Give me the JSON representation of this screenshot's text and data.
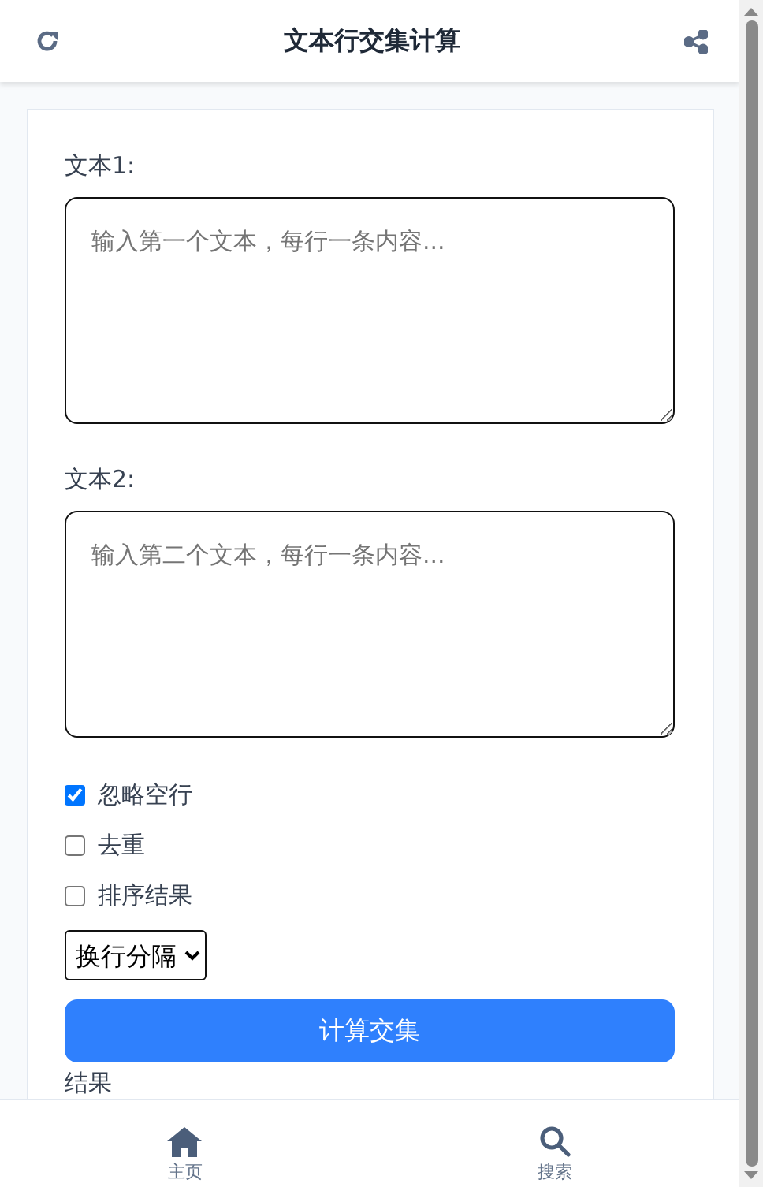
{
  "header": {
    "title": "文本行交集计算"
  },
  "form": {
    "text1": {
      "label": "文本1:",
      "placeholder": "输入第一个文本，每行一条内容..."
    },
    "text2": {
      "label": "文本2:",
      "placeholder": "输入第二个文本，每行一条内容..."
    },
    "options": [
      {
        "label": "忽略空行",
        "checked": true
      },
      {
        "label": "去重",
        "checked": false
      },
      {
        "label": "排序结果",
        "checked": false
      }
    ],
    "separator": {
      "value": "换行分隔"
    },
    "submit": {
      "label": "计算交集"
    },
    "result": {
      "label": "结果"
    }
  },
  "bottom_nav": [
    {
      "kind": "home",
      "label": "主页"
    },
    {
      "kind": "search",
      "label": "搜索"
    }
  ]
}
